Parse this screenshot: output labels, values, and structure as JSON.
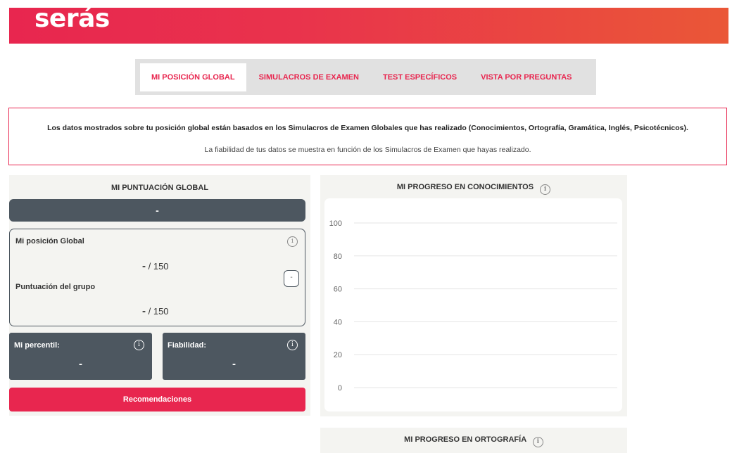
{
  "header": {
    "logo": "serás",
    "accent_color": "#e8264f"
  },
  "tabs": [
    {
      "label": "MI POSICIÓN GLOBAL",
      "active": true
    },
    {
      "label": "SIMULACROS DE EXAMEN",
      "active": false
    },
    {
      "label": "TEST ESPECÍFICOS",
      "active": false
    },
    {
      "label": "VISTA POR PREGUNTAS",
      "active": false
    }
  ],
  "info": {
    "line1": "Los datos mostrados sobre tu posición global están basados en los Simulacros de Examen Globales que has realizado (Conocimientos, Ortografía, Gramática, Inglés, Psicotécnicos).",
    "line2": "La fiabilidad de tus datos se muestra en función de los Simulacros de Examen que hayas realizado."
  },
  "global_score": {
    "title": "MI PUNTUACIÓN GLOBAL",
    "score": "-",
    "position_label": "Mi posición Global",
    "position_value": "-",
    "position_max": "/ 150",
    "group_label": "Puntuación del grupo",
    "group_value": "-",
    "group_max": "/ 150",
    "side_button": "-",
    "percentile_label": "Mi percentil:",
    "percentile_value": "-",
    "reliability_label": "Fiabilidad:",
    "reliability_value": "-",
    "recommendations_button": "Recomendaciones"
  },
  "progress_knowledge": {
    "title": "MI PROGRESO EN CONOCIMIENTOS",
    "chart_data": {
      "type": "line",
      "title": "MI PROGRESO EN CONOCIMIENTOS",
      "x": [],
      "series": [],
      "y_ticks": [
        100,
        80,
        60,
        40,
        20,
        0
      ],
      "ylim": [
        0,
        100
      ],
      "grid": true
    }
  },
  "progress_spelling": {
    "title": "MI PROGRESO EN ORTOGRAFÍA"
  },
  "icons": {
    "info": "i"
  }
}
